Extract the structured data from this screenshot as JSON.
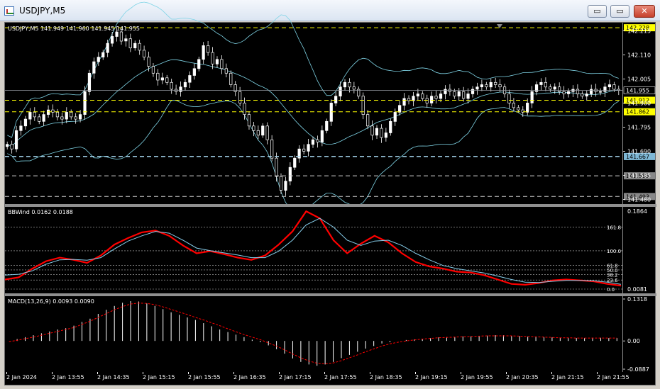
{
  "window": {
    "title": "USDJPY,M5",
    "buttons": {
      "minimize": "▭",
      "maximize": "▭",
      "close": "✕"
    }
  },
  "colors": {
    "background": "#000000",
    "candle": "#ffffff",
    "bollinger": "#7fd4e6",
    "level_yellow": "#ffff00",
    "level_blue": "#a8d8f0",
    "bbwind_main": "#ff0000",
    "bbwind_signal": "#87ceeb",
    "macd_hist": "#ffffff",
    "macd_signal": "#ff0000"
  },
  "main": {
    "header": "USDJPY,M5  141.949 141.960 141.945 141.955",
    "ticks": [
      "142.215",
      "142.110",
      "142.005",
      "141.900",
      "141.795",
      "141.690",
      "141.585",
      "141.480"
    ],
    "current_price": "141.955",
    "levels": [
      {
        "label": "142.228",
        "style": "yellow"
      },
      {
        "label": "141.912",
        "style": "yellow"
      },
      {
        "label": "141.862",
        "style": "yellow"
      },
      {
        "label": "141.667",
        "style": "blue"
      },
      {
        "label": "141.583",
        "style": "white"
      },
      {
        "label": "141.493",
        "style": "white"
      }
    ]
  },
  "bbwind": {
    "header": "BBWind 0.0162 0.0188",
    "top": "0.1864",
    "bottom": "0.0081",
    "fib_labels": [
      "161.8",
      "100.0",
      "61.8",
      "50.0",
      "38.2",
      "23.6",
      "0.0"
    ]
  },
  "macd": {
    "header": "MACD(13,26,9) 0.0093 0.0090",
    "ticks": [
      "0.1318",
      "0.00",
      "-0.0887"
    ]
  },
  "x_labels": [
    "2 Jan 2024",
    "2 Jan 13:55",
    "2 Jan 14:35",
    "2 Jan 15:15",
    "2 Jan 15:55",
    "2 Jan 16:35",
    "2 Jan 17:15",
    "2 Jan 17:55",
    "2 Jan 18:35",
    "2 Jan 19:15",
    "2 Jan 19:55",
    "2 Jan 20:35",
    "2 Jan 21:15",
    "2 Jan 21:55"
  ],
  "chart_data": [
    {
      "type": "candlestick",
      "title": "USDJPY,M5",
      "ylim": [
        141.46,
        142.25
      ],
      "close": [
        141.72,
        141.7,
        141.78,
        141.8,
        141.83,
        141.86,
        141.84,
        141.82,
        141.85,
        141.87,
        141.86,
        141.84,
        141.83,
        141.86,
        141.84,
        141.83,
        141.85,
        141.95,
        142.03,
        142.08,
        142.1,
        142.12,
        142.16,
        142.19,
        142.21,
        142.17,
        142.18,
        142.14,
        142.16,
        142.13,
        142.1,
        142.06,
        142.03,
        142.0,
        142.01,
        141.99,
        141.96,
        141.95,
        141.97,
        141.99,
        142.02,
        142.05,
        142.09,
        142.15,
        142.12,
        142.07,
        142.09,
        142.05,
        142.03,
        141.98,
        141.95,
        141.9,
        141.85,
        141.8,
        141.78,
        141.76,
        141.8,
        141.74,
        141.66,
        141.58,
        141.52,
        141.56,
        141.62,
        141.66,
        141.7,
        141.69,
        141.72,
        141.74,
        141.73,
        141.78,
        141.82,
        141.9,
        141.93,
        141.97,
        141.99,
        141.97,
        141.96,
        141.93,
        141.85,
        141.8,
        141.76,
        141.79,
        141.75,
        141.77,
        141.82,
        141.86,
        141.89,
        141.92,
        141.91,
        141.93,
        141.94,
        141.92,
        141.9,
        141.93,
        141.92,
        141.94,
        141.96,
        141.95,
        141.93,
        141.95,
        141.92,
        141.94,
        141.96,
        141.97,
        141.98,
        141.97,
        141.99,
        141.98,
        141.97,
        141.94,
        141.9,
        141.88,
        141.87,
        141.86,
        141.9,
        141.95,
        141.98,
        141.99,
        141.97,
        141.96,
        141.97,
        141.95,
        141.94,
        141.95,
        141.96,
        141.94,
        141.93,
        141.94,
        141.96,
        141.95,
        141.95,
        141.97,
        141.98,
        141.96,
        141.955
      ]
    },
    {
      "type": "line",
      "title": "BBWind 0.0162 0.0188",
      "ylim": [
        0.0081,
        0.1864
      ],
      "series": [
        {
          "name": "BBWind",
          "values": [
            0.03,
            0.035,
            0.055,
            0.072,
            0.08,
            0.075,
            0.068,
            0.085,
            0.11,
            0.125,
            0.138,
            0.142,
            0.13,
            0.108,
            0.09,
            0.095,
            0.088,
            0.08,
            0.075,
            0.085,
            0.11,
            0.14,
            0.186,
            0.17,
            0.12,
            0.09,
            0.112,
            0.13,
            0.115,
            0.09,
            0.07,
            0.06,
            0.055,
            0.048,
            0.046,
            0.04,
            0.03,
            0.02,
            0.018,
            0.022,
            0.028,
            0.03,
            0.028,
            0.026,
            0.02,
            0.016
          ]
        },
        {
          "name": "",
          "values": [
            0.04,
            0.042,
            0.05,
            0.065,
            0.075,
            0.076,
            0.074,
            0.08,
            0.1,
            0.118,
            0.13,
            0.14,
            0.136,
            0.12,
            0.102,
            0.096,
            0.091,
            0.086,
            0.08,
            0.08,
            0.095,
            0.12,
            0.155,
            0.17,
            0.15,
            0.12,
            0.108,
            0.118,
            0.12,
            0.108,
            0.09,
            0.075,
            0.062,
            0.055,
            0.05,
            0.045,
            0.038,
            0.03,
            0.024,
            0.023,
            0.026,
            0.028,
            0.028,
            0.027,
            0.024,
            0.019
          ]
        }
      ]
    },
    {
      "type": "bar",
      "title": "MACD(13,26,9) 0.0093 0.0090",
      "ylim": [
        -0.0887,
        0.1318
      ],
      "series": [
        {
          "name": "MACD",
          "values": [
            0.0,
            0.006,
            0.012,
            0.018,
            0.024,
            0.03,
            0.036,
            0.04,
            0.048,
            0.06,
            0.07,
            0.085,
            0.098,
            0.11,
            0.12,
            0.125,
            0.124,
            0.118,
            0.11,
            0.1,
            0.09,
            0.082,
            0.074,
            0.066,
            0.056,
            0.046,
            0.036,
            0.028,
            0.02,
            0.012,
            0.004,
            -0.004,
            -0.014,
            -0.026,
            -0.04,
            -0.055,
            -0.066,
            -0.074,
            -0.078,
            -0.074,
            -0.066,
            -0.054,
            -0.044,
            -0.034,
            -0.024,
            -0.016,
            -0.008,
            -0.004,
            0.0,
            0.003,
            0.005,
            0.007,
            0.009,
            0.011,
            0.012,
            0.013,
            0.014,
            0.015,
            0.016,
            0.017,
            0.018,
            0.018,
            0.017,
            0.015,
            0.013,
            0.012,
            0.012,
            0.011,
            0.01,
            0.009,
            0.009,
            0.009,
            0.01,
            0.01,
            0.009,
            0.0093
          ]
        },
        {
          "name": "",
          "values": [
            -0.002,
            0.002,
            0.007,
            0.012,
            0.018,
            0.024,
            0.03,
            0.036,
            0.042,
            0.052,
            0.062,
            0.074,
            0.086,
            0.098,
            0.108,
            0.116,
            0.119,
            0.118,
            0.114,
            0.107,
            0.099,
            0.091,
            0.083,
            0.074,
            0.066,
            0.057,
            0.048,
            0.038,
            0.029,
            0.02,
            0.012,
            0.004,
            -0.006,
            -0.016,
            -0.028,
            -0.041,
            -0.053,
            -0.063,
            -0.07,
            -0.072,
            -0.069,
            -0.062,
            -0.053,
            -0.044,
            -0.034,
            -0.025,
            -0.016,
            -0.009,
            -0.004,
            0.0,
            0.003,
            0.006,
            0.008,
            0.01,
            0.011,
            0.012,
            0.013,
            0.014,
            0.015,
            0.016,
            0.016,
            0.016,
            0.016,
            0.015,
            0.014,
            0.013,
            0.012,
            0.011,
            0.01,
            0.01,
            0.009,
            0.009,
            0.009,
            0.009,
            0.009,
            0.009
          ]
        }
      ]
    }
  ]
}
